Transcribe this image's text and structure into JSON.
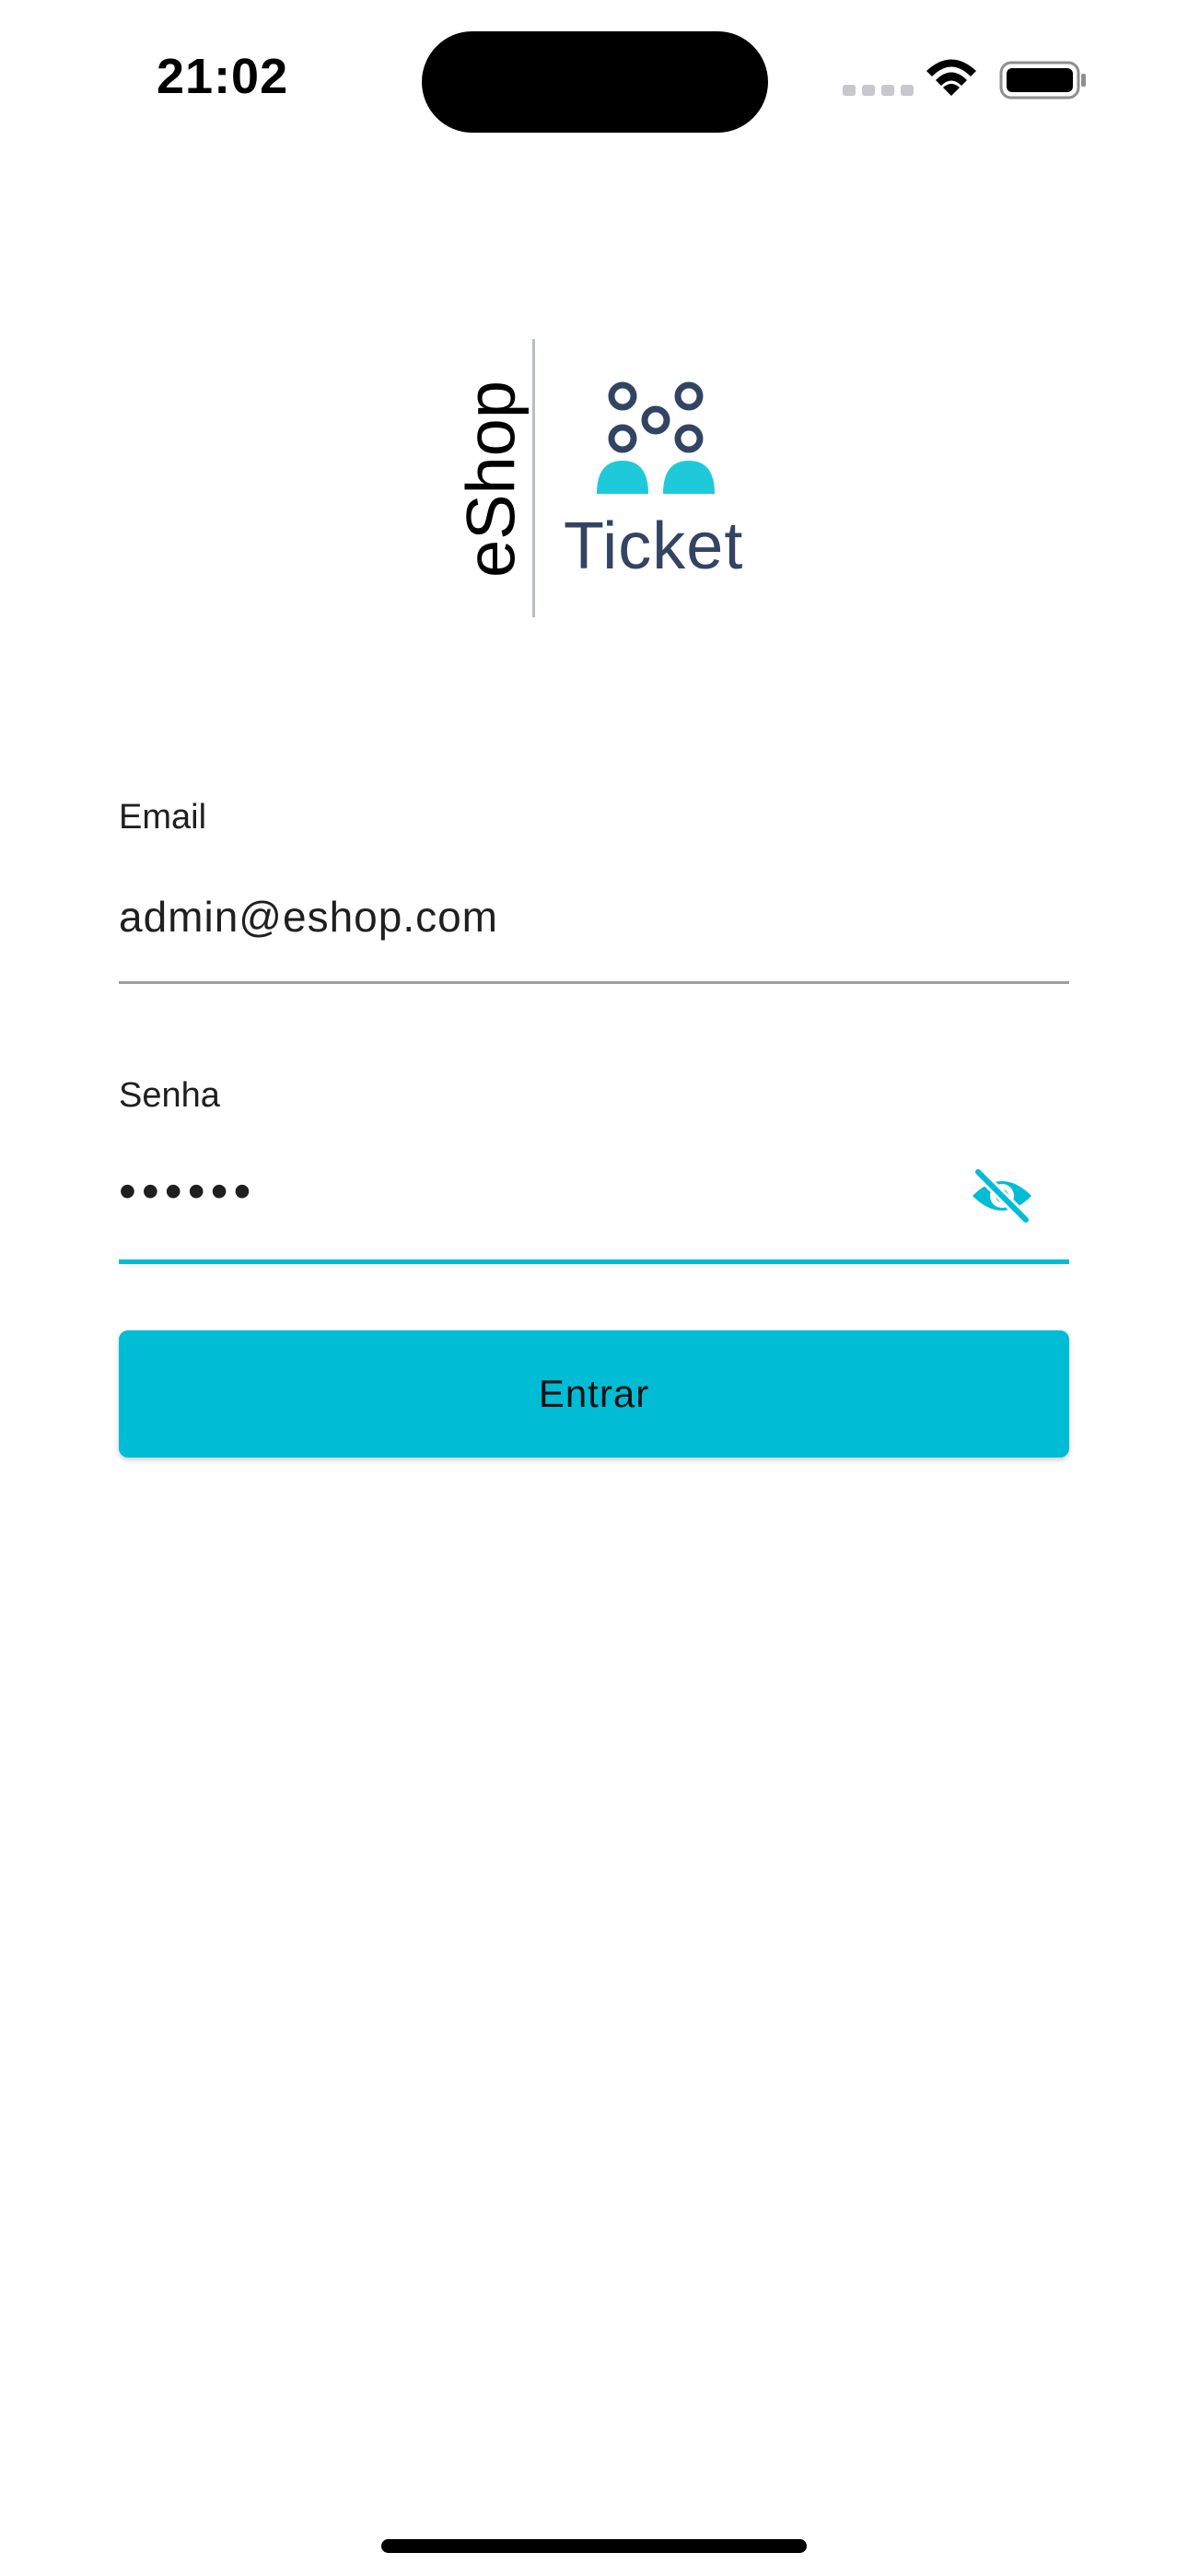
{
  "status_bar": {
    "time": "21:02"
  },
  "logo": {
    "brand": "eShop",
    "product": "Ticket",
    "people_icon": "people-group-icon",
    "accent_color": "#1ECAD9",
    "dark_color": "#334463"
  },
  "form": {
    "email": {
      "label": "Email",
      "value": "admin@eshop.com"
    },
    "password": {
      "label": "Senha",
      "value": "••••••",
      "visibility_icon": "eye-off-icon"
    },
    "submit_label": "Entrar"
  },
  "theme": {
    "primary": "#00BCD4",
    "underline": "#9E9E9E",
    "background": "#FFFFFF"
  }
}
